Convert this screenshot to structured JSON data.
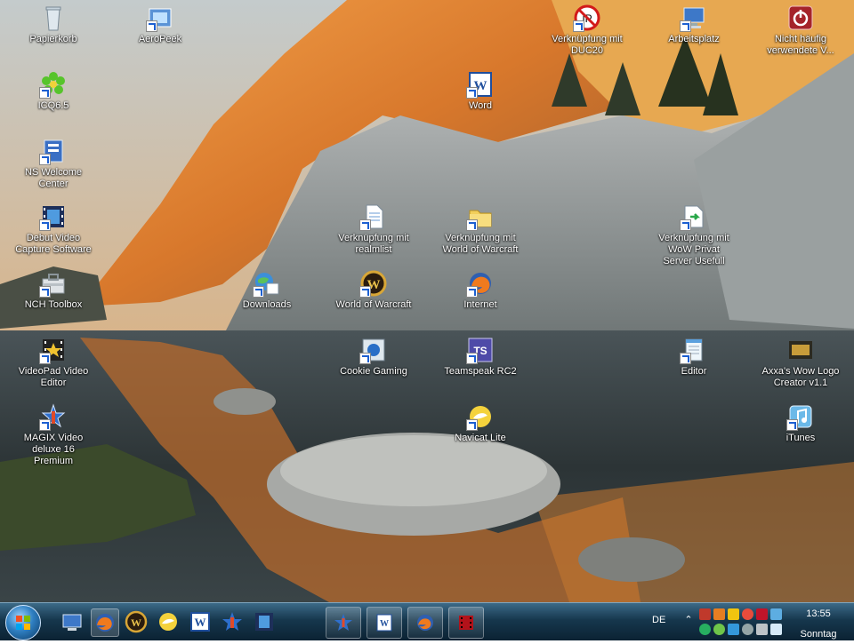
{
  "desktop_icons": [
    {
      "label": "Papierkorb",
      "icon": "recycle-bin-icon"
    },
    {
      "label": "AeroPeek",
      "icon": "aeropeek-shortcut-icon"
    },
    {
      "label": "Verknüpfung mit DUC20",
      "icon": "duc-shortcut-icon"
    },
    {
      "label": "Arbeitsplatz",
      "icon": "computer-icon"
    },
    {
      "label": "Nicht häufig verwendete V...",
      "icon": "power-icon"
    },
    {
      "label": "ICQ6.5",
      "icon": "icq-flower-icon"
    },
    {
      "label": "Word",
      "icon": "word-icon"
    },
    {
      "label": "NS Welcome Center",
      "icon": "welcome-center-icon"
    },
    {
      "label": "Debut Video Capture Software",
      "icon": "film-icon"
    },
    {
      "label": "Verknüpfung mit realmlist",
      "icon": "text-file-icon"
    },
    {
      "label": "Verknüpfung mit World of Warcraft",
      "icon": "folder-icon"
    },
    {
      "label": "Verknüpfung mit WoW Privat Server Usefull",
      "icon": "document-arrow-icon"
    },
    {
      "label": "NCH Toolbox",
      "icon": "toolbox-icon"
    },
    {
      "label": "Downloads",
      "icon": "downloads-globe-icon"
    },
    {
      "label": "World of Warcraft",
      "icon": "wow-icon"
    },
    {
      "label": "Internet",
      "icon": "firefox-icon"
    },
    {
      "label": "VideoPad Video Editor",
      "icon": "videopad-icon"
    },
    {
      "label": "Cookie Gaming",
      "icon": "cookie-gaming-icon"
    },
    {
      "label": "Teamspeak RC2",
      "icon": "teamspeak-icon"
    },
    {
      "label": "Editor",
      "icon": "notepad-icon"
    },
    {
      "label": "Axxa's Wow Logo Creator v1.1",
      "icon": "wow-logo-creator-icon"
    },
    {
      "label": "MAGIX Video deluxe 16 Premium",
      "icon": "magix-icon"
    },
    {
      "label": "Navicat Lite",
      "icon": "navicat-icon"
    },
    {
      "label": "iTunes",
      "icon": "itunes-icon"
    }
  ],
  "taskbar": {
    "language": "DE",
    "clock_time": "13:55",
    "clock_day": "Sonntag"
  }
}
